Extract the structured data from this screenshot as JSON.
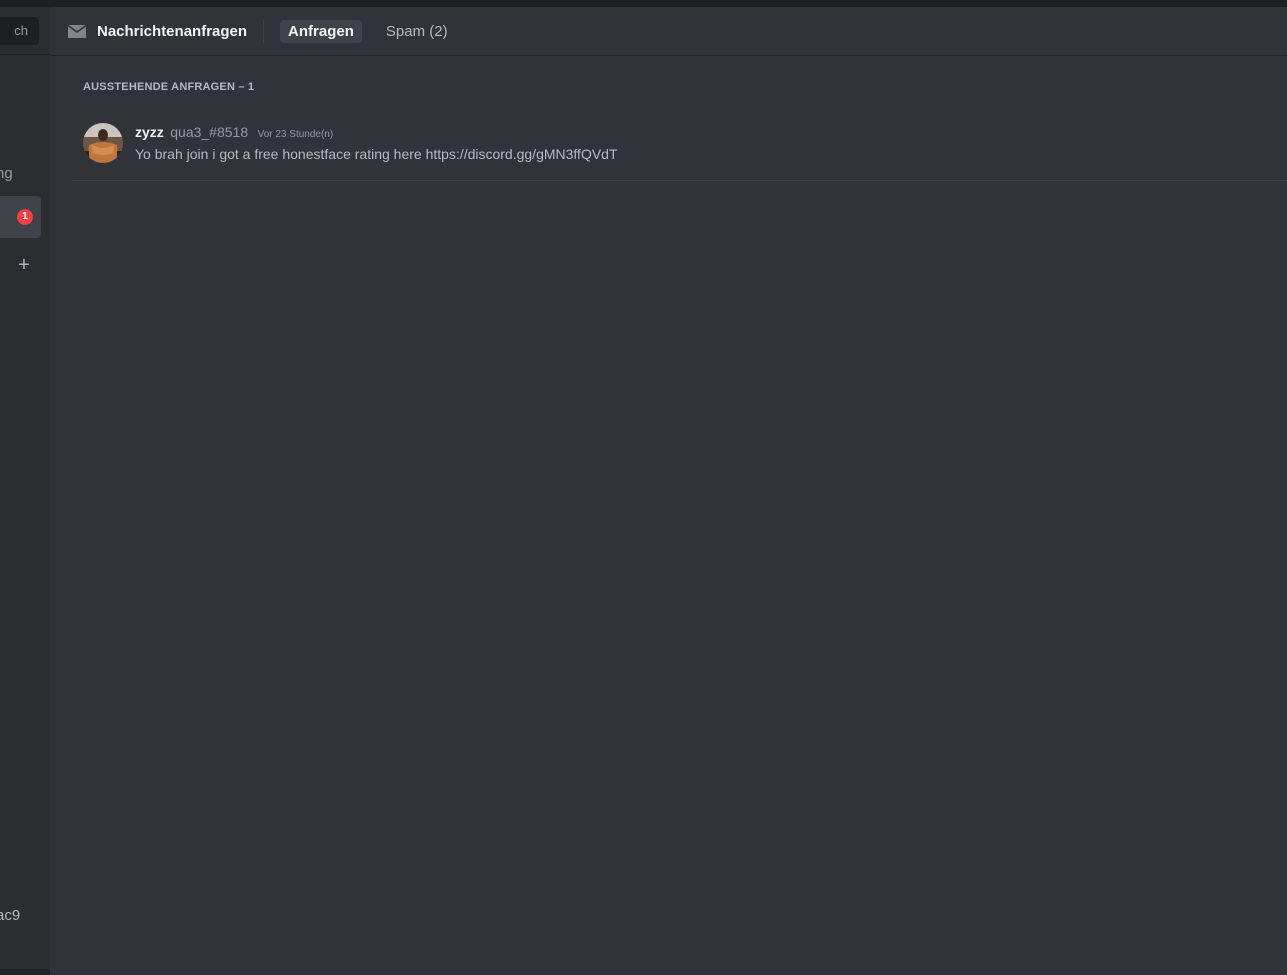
{
  "sidebar": {
    "search_partial": "ch",
    "item1_partial": "ng",
    "selected_partial": ".",
    "badge_count": "1",
    "add_symbol": "+",
    "user_partial": "ac9"
  },
  "header": {
    "icon": "mail-icon",
    "title": "Nachrichtenanfragen",
    "tabs": [
      {
        "label": "Anfragen",
        "active": true
      },
      {
        "label": "Spam (2)",
        "active": false
      }
    ]
  },
  "main": {
    "section_title": "AUSSTEHENDE ANFRAGEN – 1",
    "requests": [
      {
        "display_name": "zyzz",
        "username": "qua3_#8518",
        "timestamp": "Vor 23 Stunde(n)",
        "message": "Yo brah join i got a free honestface rating here https://discord.gg/gMN3ffQVdT",
        "avatar_icon": "user-avatar"
      }
    ]
  },
  "colors": {
    "background": "#313338",
    "sidebar": "#2b2d31",
    "badge": "#f23f43",
    "selected_tab": "#404249"
  }
}
